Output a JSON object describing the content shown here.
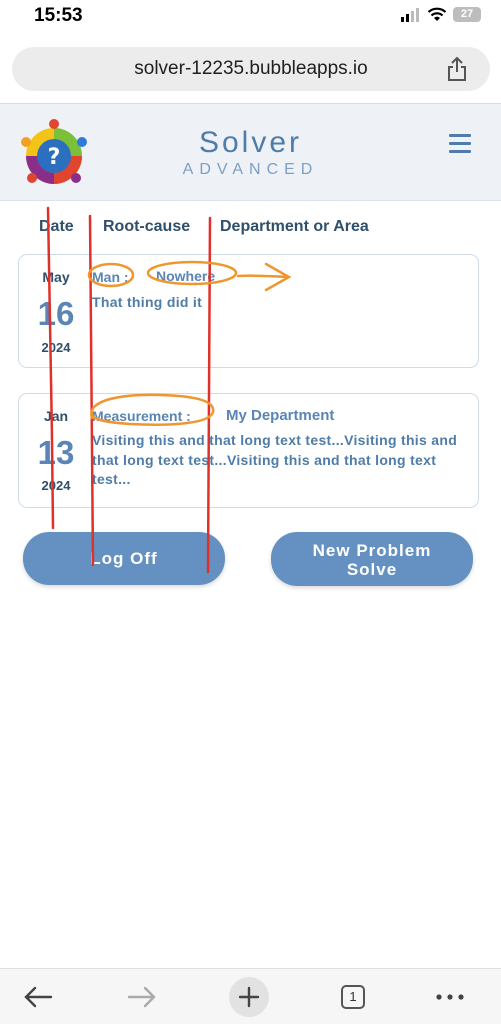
{
  "status": {
    "time": "15:53",
    "battery": "27"
  },
  "browser": {
    "url": "solver-12235.bubbleapps.io",
    "tab_count": "1"
  },
  "app": {
    "title": "Solver",
    "subtitle": "ADVANCED"
  },
  "columns": {
    "date": "Date",
    "root_cause": "Root-cause",
    "department": "Department or Area"
  },
  "entries": [
    {
      "month": "May",
      "day": "16",
      "year": "2024",
      "root_cause": "Man :",
      "department": "Nowhere",
      "description": "That thing did it"
    },
    {
      "month": "Jan",
      "day": "13",
      "year": "2024",
      "root_cause": "Measurement :",
      "department": "My Department",
      "description": "Visiting this and that long text test...Visiting this and that long text test...Visiting this and that long text test..."
    }
  ],
  "buttons": {
    "log_off": "Log Off",
    "new_problem_line1": "New Problem",
    "new_problem_line2": "Solve"
  },
  "colors": {
    "accent": "#6591c2",
    "title": "#4f7ca8",
    "annotation_red": "#e0302a",
    "annotation_orange": "#f0962e"
  }
}
